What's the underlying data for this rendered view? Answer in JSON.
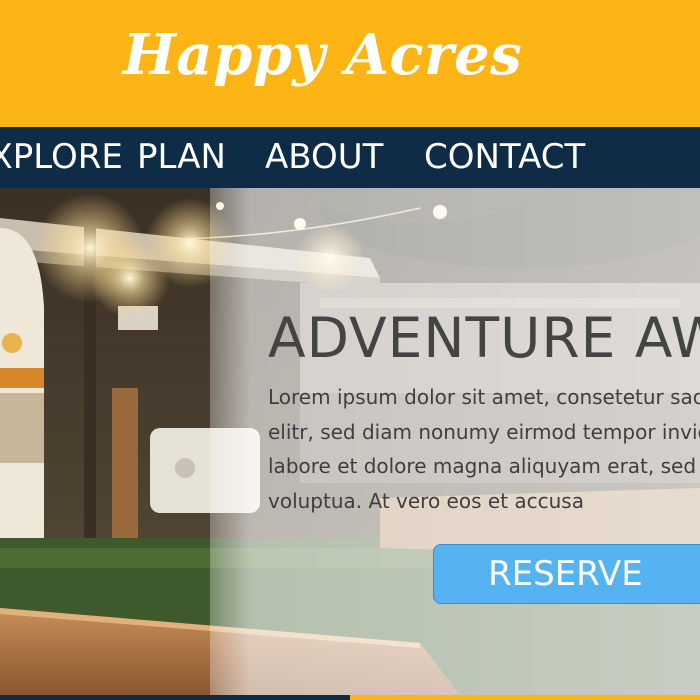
{
  "brand": {
    "logo_text": "Happy Acres"
  },
  "nav": {
    "items": [
      {
        "label": "EXPLORE"
      },
      {
        "label": "PLAN"
      },
      {
        "label": "ABOUT"
      },
      {
        "label": "CONTACT"
      }
    ]
  },
  "hero": {
    "title": "ADVENTURE AWAITS",
    "body_lines": [
      "Lorem ipsum dolor sit amet, consetetur sadipscing",
      "elitr, sed diam nonumy eirmod tempor invidunt ut",
      "labore et dolore magna aliquyam erat, sed diam",
      "voluptua. At vero eos et accusa"
    ],
    "reserve_label": "RESERVE"
  },
  "colors": {
    "header_bg": "#fdb515",
    "nav_bg": "#0f2c46",
    "button_bg": "#54b3f0",
    "title_text": "#444444"
  }
}
